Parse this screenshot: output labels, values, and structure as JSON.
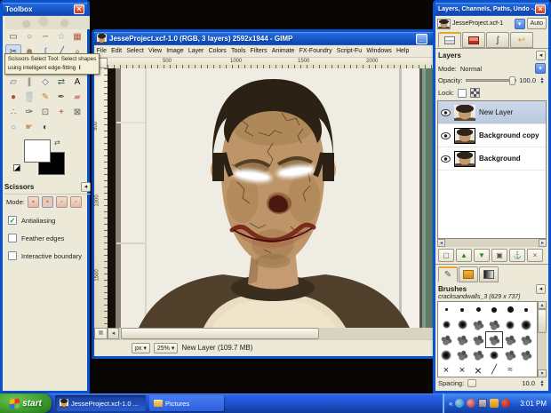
{
  "icons": {
    "close": "×",
    "minimize": "_",
    "dropdown": "▾",
    "menu_left": "◂",
    "scroll_left": "◂",
    "scroll_right": "▸",
    "scroll_up": "▴",
    "scroll_down": "▾",
    "check": "✓",
    "swap": "⇄"
  },
  "toolbox": {
    "title": "Toolbox",
    "tooltip": {
      "line1": "Scissors Select Tool: Select shapes",
      "line2": "using intelligent edge-fitting",
      "shortcut": "I"
    },
    "tools": [
      {
        "name": "rectangle-select",
        "glyph": "▭",
        "color": "#54524a"
      },
      {
        "name": "ellipse-select",
        "glyph": "○",
        "color": "#7a786e"
      },
      {
        "name": "free-select",
        "glyph": "∽",
        "color": "#8a7a5a"
      },
      {
        "name": "fuzzy-select",
        "glyph": "☆",
        "color": "#8898a8"
      },
      {
        "name": "select-by-color",
        "glyph": "▦",
        "color": "#b05a3c"
      },
      {
        "name": "scissors-select",
        "glyph": "✂",
        "color": "#3a3a34",
        "active": true
      },
      {
        "name": "foreground-select",
        "glyph": "☻",
        "color": "#9a7a54"
      },
      {
        "name": "paths",
        "glyph": "∫",
        "color": "#4a6a9a"
      },
      {
        "name": "color-picker",
        "glyph": "╱",
        "color": "#3a5a8a"
      },
      {
        "name": "zoom",
        "glyph": "⌕",
        "color": "#4a5a6a"
      },
      {
        "name": "measure",
        "glyph": "∠",
        "color": "#6a665a"
      },
      {
        "name": "move",
        "glyph": "↔",
        "color": "#44566a"
      },
      {
        "name": "align",
        "glyph": "≡",
        "color": "#7a7668"
      },
      {
        "name": "crop",
        "glyph": "#",
        "color": "#8a6a3a"
      },
      {
        "name": "rotate",
        "glyph": "↻",
        "color": "#4a6a9a"
      },
      {
        "name": "scale",
        "glyph": "▱",
        "color": "#5a6a8a"
      },
      {
        "name": "shear",
        "glyph": "∥",
        "color": "#6a6a5a"
      },
      {
        "name": "perspective",
        "glyph": "◇",
        "color": "#5a6a8a"
      },
      {
        "name": "flip",
        "glyph": "⇄",
        "color": "#4a6a5a"
      },
      {
        "name": "text",
        "glyph": "A",
        "color": "#111111"
      },
      {
        "name": "bucket-fill",
        "glyph": "●",
        "color": "#b05038"
      },
      {
        "name": "blend",
        "glyph": "▒",
        "color": "#6888aa"
      },
      {
        "name": "pencil",
        "glyph": "✎",
        "color": "#b8862a"
      },
      {
        "name": "paintbrush",
        "glyph": "✒",
        "color": "#7a5436"
      },
      {
        "name": "eraser",
        "glyph": "▰",
        "color": "#d08a8a"
      },
      {
        "name": "airbrush",
        "glyph": "∴",
        "color": "#56667a"
      },
      {
        "name": "ink",
        "glyph": "✑",
        "color": "#3a3a44"
      },
      {
        "name": "clone",
        "glyph": "⊡",
        "color": "#66625a"
      },
      {
        "name": "heal",
        "glyph": "+",
        "color": "#b03a3a"
      },
      {
        "name": "perspective-clone",
        "glyph": "⊠",
        "color": "#66625a"
      },
      {
        "name": "blur-sharpen",
        "glyph": "○",
        "color": "#6a9ac8"
      },
      {
        "name": "smudge",
        "glyph": "☛",
        "color": "#c89a6a"
      },
      {
        "name": "dodge-burn",
        "glyph": "◐",
        "color": "#44403a"
      }
    ],
    "options": {
      "title": "Scissors",
      "mode_label": "Mode:",
      "checkboxes": [
        {
          "label": "Antialiasing",
          "checked": true
        },
        {
          "label": "Feather edges",
          "checked": false
        },
        {
          "label": "Interactive boundary",
          "checked": false
        }
      ]
    }
  },
  "image_window": {
    "title": "JesseProject.xcf-1.0 (RGB, 3 layers) 2592x1944 - GIMP",
    "menus": [
      "File",
      "Edit",
      "Select",
      "View",
      "Image",
      "Layer",
      "Colors",
      "Tools",
      "Filters",
      "Animate",
      "FX-Foundry",
      "Script-Fu",
      "Windows",
      "Help"
    ],
    "hruler": [
      {
        "label": "500",
        "pos": 62
      },
      {
        "label": "1000",
        "pos": 138
      },
      {
        "label": "1500",
        "pos": 214
      },
      {
        "label": "2000",
        "pos": 291
      }
    ],
    "vruler": [
      {
        "label": "500",
        "pos": 62
      },
      {
        "label": "1000",
        "pos": 146
      },
      {
        "label": "1500",
        "pos": 230
      }
    ],
    "status": {
      "unit": "px",
      "zoom": "25%",
      "message": "New Layer (109.7 MB)"
    }
  },
  "dock": {
    "title": "Layers, Channels, Paths, Undo -...",
    "image_combo": "JesseProject.xcf-1",
    "auto_label": "Auto",
    "layers_panel": {
      "title": "Layers",
      "mode_label": "Mode:",
      "mode_value": "Normal",
      "opacity_label": "Opacity:",
      "opacity_value": "100.0",
      "lock_label": "Lock:",
      "rows": [
        {
          "name": "New Layer",
          "selected": true
        },
        {
          "name": "Background copy",
          "selected": false
        },
        {
          "name": "Background",
          "selected": false
        }
      ],
      "buttons": [
        {
          "name": "new-layer",
          "glyph": "▢",
          "color": "#555555"
        },
        {
          "name": "raise-layer",
          "glyph": "▲",
          "color": "#2a8a2a"
        },
        {
          "name": "lower-layer",
          "glyph": "▼",
          "color": "#2a8a2a"
        },
        {
          "name": "duplicate-layer",
          "glyph": "▣",
          "color": "#555555"
        },
        {
          "name": "anchor-layer",
          "glyph": "⚓",
          "color": "#444444"
        },
        {
          "name": "delete-layer",
          "glyph": "×",
          "color": "#884444"
        }
      ]
    },
    "brushes_panel": {
      "title": "Brushes",
      "brush_name": "cracksandwalls_3 (629 x 737)",
      "spacing_label": "Spacing:",
      "spacing_value": "10.0",
      "cells": [
        {
          "t": "dot",
          "s": 3
        },
        {
          "t": "dot",
          "s": 4
        },
        {
          "t": "dot",
          "s": 5
        },
        {
          "t": "dot",
          "s": 6
        },
        {
          "t": "dot",
          "s": 7
        },
        {
          "t": "dot",
          "s": 4
        },
        {
          "t": "fuzzy",
          "s": 9
        },
        {
          "t": "fuzzy",
          "s": 11
        },
        {
          "t": "blob"
        },
        {
          "t": "blob"
        },
        {
          "t": "fuzzy",
          "s": 10
        },
        {
          "t": "fuzzy",
          "s": 12
        },
        {
          "t": "blob"
        },
        {
          "t": "blob"
        },
        {
          "t": "blob"
        },
        {
          "t": "crack",
          "sel": true
        },
        {
          "t": "blob"
        },
        {
          "t": "blob"
        },
        {
          "t": "fuzzy",
          "s": 12
        },
        {
          "t": "blob"
        },
        {
          "t": "blob"
        },
        {
          "t": "fuzzy",
          "s": 10
        },
        {
          "t": "blob"
        },
        {
          "t": "blob"
        },
        {
          "t": "x"
        },
        {
          "t": "x"
        },
        {
          "t": "X"
        },
        {
          "t": "stroke"
        },
        {
          "t": "wing"
        }
      ]
    }
  },
  "taskbar": {
    "start_label": "start",
    "tasks": [
      {
        "label": "JesseProject.xcf-1.0 ...",
        "active": true
      },
      {
        "label": "Pictures",
        "active": false
      }
    ],
    "clock": "3:01 PM"
  }
}
